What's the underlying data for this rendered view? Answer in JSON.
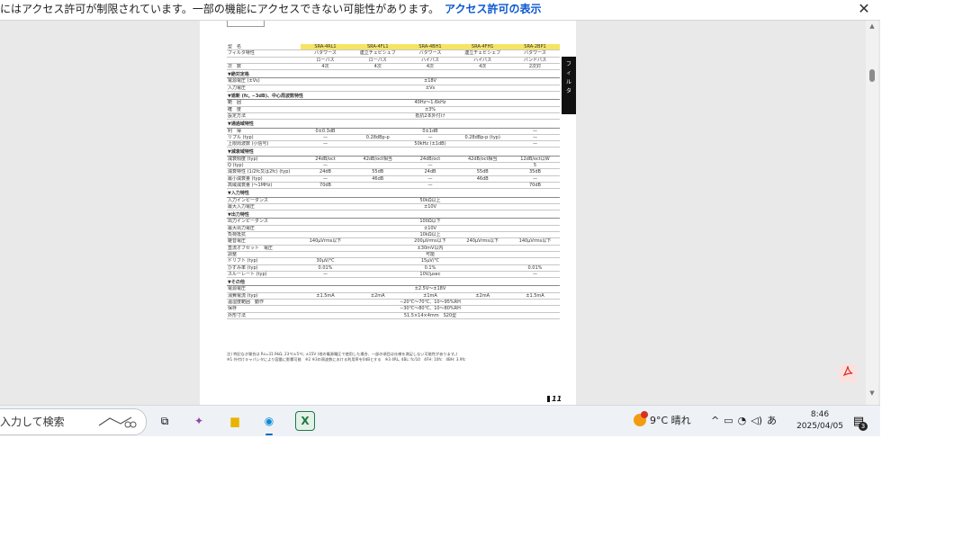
{
  "infobar": {
    "message": "にはアクセス許可が制限されています。一部の機能にアクセスできない可能性があります。",
    "link": "アクセス許可の表示",
    "close_glyph": "✕"
  },
  "document": {
    "side_tab": [
      "フ",
      "ィ",
      "ル",
      "タ"
    ],
    "page_number": "11",
    "models": [
      "SRA-4RL1",
      "SRA-4FL1",
      "SRA-4BH1",
      "SRA-4FH1",
      "SRA-2BP1"
    ],
    "rows": [
      {
        "label": "型　名",
        "cells": [
          "SRA-4RL1",
          "SRA-4FL1",
          "SRA-4BH1",
          "SRA-4FH1",
          "SRA-2BP1"
        ],
        "header": true
      },
      {
        "label": "フィルタ特性",
        "cells": [
          "バタワース",
          "連立チェビシェフ",
          "バタワース",
          "連立チェビシェフ",
          "バタワース"
        ]
      },
      {
        "label": "",
        "cells": [
          "ローパス",
          "ローパス",
          "ハイパス",
          "ハイパス",
          "バンドパス"
        ]
      },
      {
        "label": "次　数",
        "cells": [
          "4次",
          "4次",
          "4次",
          "4次",
          "2次対"
        ]
      },
      {
        "label": "▼絶対定格",
        "section": true
      },
      {
        "label": "電源電圧 (±Vs)",
        "span": "±18V"
      },
      {
        "label": "入力電圧",
        "span": "±Vs"
      },
      {
        "label": "▼遮断 (fc, −3dB)、中心周波数特性",
        "section": true
      },
      {
        "label": "範　囲",
        "span": "40Hz〜1.6kHz"
      },
      {
        "label": "確　度",
        "span": "±3%"
      },
      {
        "label": "設定方法",
        "span": "抵抗2本外付け"
      },
      {
        "label": "▼通過域特性",
        "section": true
      },
      {
        "label": "利　得",
        "cells": [
          "0±0.3dB",
          "",
          "0±1dB",
          "",
          "—"
        ]
      },
      {
        "label": "リプル (typ)",
        "cells": [
          "—",
          "0.28dBp-p",
          "—",
          "0.28dBp-p (typ)",
          "—"
        ]
      },
      {
        "label": "上限周波数 (小信号)",
        "cells": [
          "—",
          "",
          "50kHz (±1dB)",
          "",
          "—"
        ]
      },
      {
        "label": "▼減衰域特性",
        "section": true
      },
      {
        "label": "減衰傾度 (typ)",
        "cells": [
          "24dB/oct",
          "42dB/oct相当",
          "24dB/oct",
          "42dB/oct相当",
          "12dB/oct以W"
        ]
      },
      {
        "label": "Q (typ)",
        "cells": [
          "—",
          "",
          "—",
          "",
          "5"
        ]
      },
      {
        "label": "減衰特性 (1/2fc又は2fc) (typ)",
        "cells": [
          "24dB",
          "55dB",
          "24dB",
          "55dB",
          "35dB"
        ]
      },
      {
        "label": "最小減衰量 (typ)",
        "cells": [
          "—",
          "46dB",
          "—",
          "46dB",
          "—"
        ]
      },
      {
        "label": "高域減衰量 (〜1MHz)",
        "cells": [
          "70dB",
          "",
          "—",
          "",
          "70dB"
        ]
      },
      {
        "label": "▼入力特性",
        "section": true
      },
      {
        "label": "入力インピーダンス",
        "span": "50kΩ以上"
      },
      {
        "label": "最大入力電圧",
        "span": "±10V"
      },
      {
        "label": "▼出力特性",
        "section": true
      },
      {
        "label": "出力インピーダンス",
        "span": "100Ω以下"
      },
      {
        "label": "最大出力電圧",
        "span": "±10V"
      },
      {
        "label": "負荷抵抗",
        "span": "10kΩ以上"
      },
      {
        "label": "雑音電圧",
        "cells": [
          "140μVrms以下",
          "",
          "200μVrms以下",
          "240μVrms以下",
          "140μVrms以下"
        ]
      },
      {
        "label": "直流オフセット　電圧",
        "span": "±30mV以内"
      },
      {
        "label": "調整",
        "span": "可能"
      },
      {
        "label": "ドリフト (typ)",
        "cells": [
          "30μV/℃",
          "",
          "15μV/℃",
          "",
          ""
        ]
      },
      {
        "label": "ひずみ率 (typ)",
        "cells": [
          "0.01%",
          "",
          "0.1%",
          "",
          "0.01%"
        ]
      },
      {
        "label": "スルーレート (typ)",
        "cells": [
          "—",
          "",
          "10V/μsec",
          "",
          "—"
        ]
      },
      {
        "label": "▼その他",
        "section": true
      },
      {
        "label": "電源電圧",
        "span": "±2.5V〜±18V"
      },
      {
        "label": "消費電流 (typ)",
        "cells": [
          "±1.5mA",
          "±2mA",
          "±1mA",
          "±2mA",
          "±1.5mA"
        ]
      },
      {
        "label": "温湿度範囲　動作",
        "span": "−20℃〜70℃、10〜95%RH"
      },
      {
        "label": "保存",
        "span": "−30℃〜80℃、10〜80%RH"
      },
      {
        "label": "外形寸法",
        "span": "51.5×14×4mm　S20型"
      }
    ],
    "footnote_1": "注) 特記なき場合は Rs=31.9kΩ, 23℃±5℃, ±15V (他の電源電圧で使用した場合、一部の項目は仕様を満足しない可能性があります。)",
    "footnote_2": "※1 外付けキャパシタにより容量に影響可能　※2 ※3の周波数における利用率を0dBとする　※3 4RL, 4BL: fc/10　4FH: 10fc　4BH: 3.9fc"
  },
  "viewer": {
    "pdf_icon": "PDF"
  },
  "taskbar": {
    "search_text": "入力して検索",
    "weather": "9°C  晴れ",
    "tray_ime": "あ",
    "time": "8:46",
    "date": "2025/04/05",
    "notification_count": "3",
    "apps": [
      {
        "name": "task-view",
        "glyph": "⧉",
        "color": "#333333"
      },
      {
        "name": "copilot",
        "glyph": "✦",
        "color": "#8e44ad"
      },
      {
        "name": "file-explorer",
        "glyph": "▆",
        "color": "#e8b400"
      },
      {
        "name": "edge",
        "glyph": "◉",
        "color": "#0a8ad6"
      },
      {
        "name": "excel",
        "glyph": "X",
        "color": "#1d7a45"
      }
    ]
  }
}
